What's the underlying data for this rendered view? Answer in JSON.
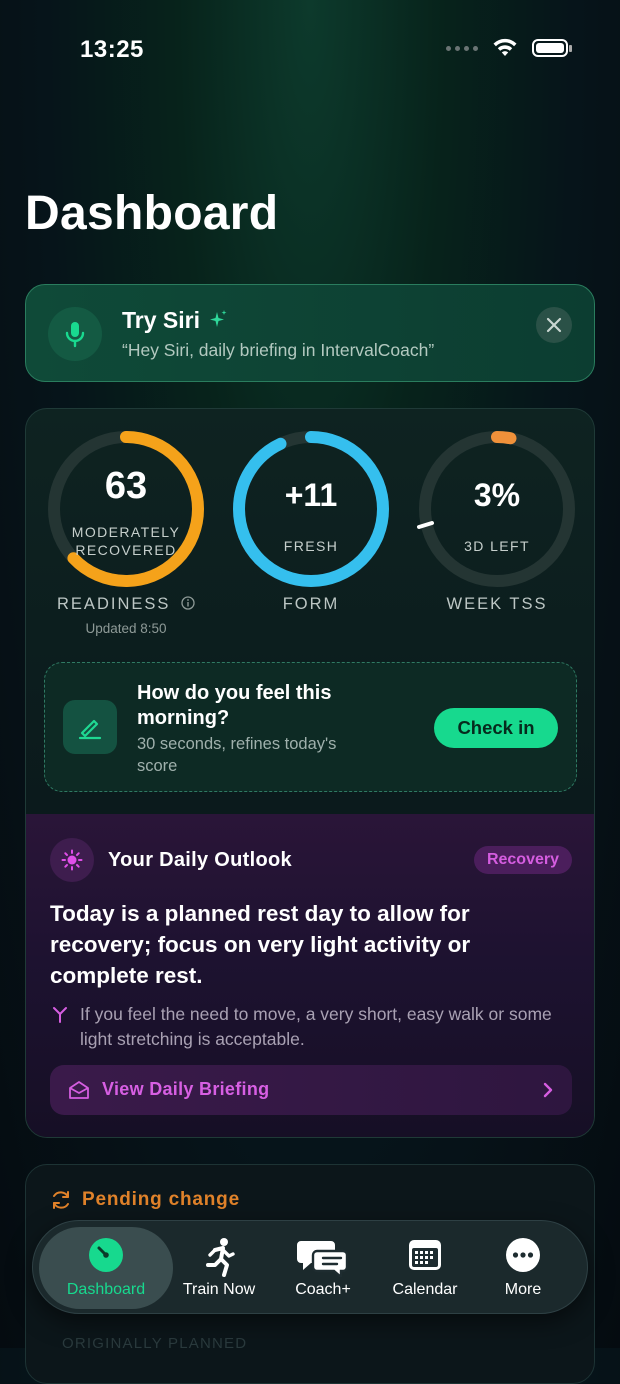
{
  "status_bar": {
    "time": "13:25"
  },
  "page": {
    "title": "Dashboard"
  },
  "siri": {
    "title": "Try Siri",
    "subtitle": "“Hey Siri, daily briefing in IntervalCoach”"
  },
  "metrics": {
    "readiness": {
      "value": "63",
      "sub_line1": "MODERATELY",
      "sub_line2": "RECOVERED",
      "label": "READINESS",
      "updated": "Updated 8:50",
      "progress": 0.63,
      "color": "#f5a21a"
    },
    "form": {
      "value": "+11",
      "sub": "FRESH",
      "label": "FORM",
      "progress": 0.93,
      "color": "#35bfee"
    },
    "week_tss": {
      "value": "3%",
      "sub": "3D LEFT",
      "label": "WEEK TSS",
      "progress": 0.03,
      "color": "#f0913a"
    }
  },
  "checkin": {
    "title": "How do you feel this morning?",
    "subtitle": "30 seconds, refines today's score",
    "button": "Check in"
  },
  "outlook": {
    "title": "Your Daily Outlook",
    "badge": "Recovery",
    "main": "Today is a planned rest day to allow for recovery; focus on very light activity or complete rest.",
    "note": "If you feel the need to move, a very short, easy walk or some light stretching is acceptable.",
    "button": "View Daily Briefing"
  },
  "pending": {
    "title": "Pending change",
    "partial_text": "ORIGINALLY PLANNED"
  },
  "tabs": [
    {
      "label": "Dashboard",
      "icon": "gauge-icon",
      "active": true
    },
    {
      "label": "Train Now",
      "icon": "runner-icon",
      "active": false
    },
    {
      "label": "Coach+",
      "icon": "chat-bubbles-icon",
      "active": false
    },
    {
      "label": "Calendar",
      "icon": "calendar-icon",
      "active": false
    },
    {
      "label": "More",
      "icon": "more-dots-icon",
      "active": false
    }
  ],
  "colors": {
    "accent_green": "#17d98e",
    "accent_purple": "#d55de0",
    "pending_orange": "#e0822a"
  }
}
